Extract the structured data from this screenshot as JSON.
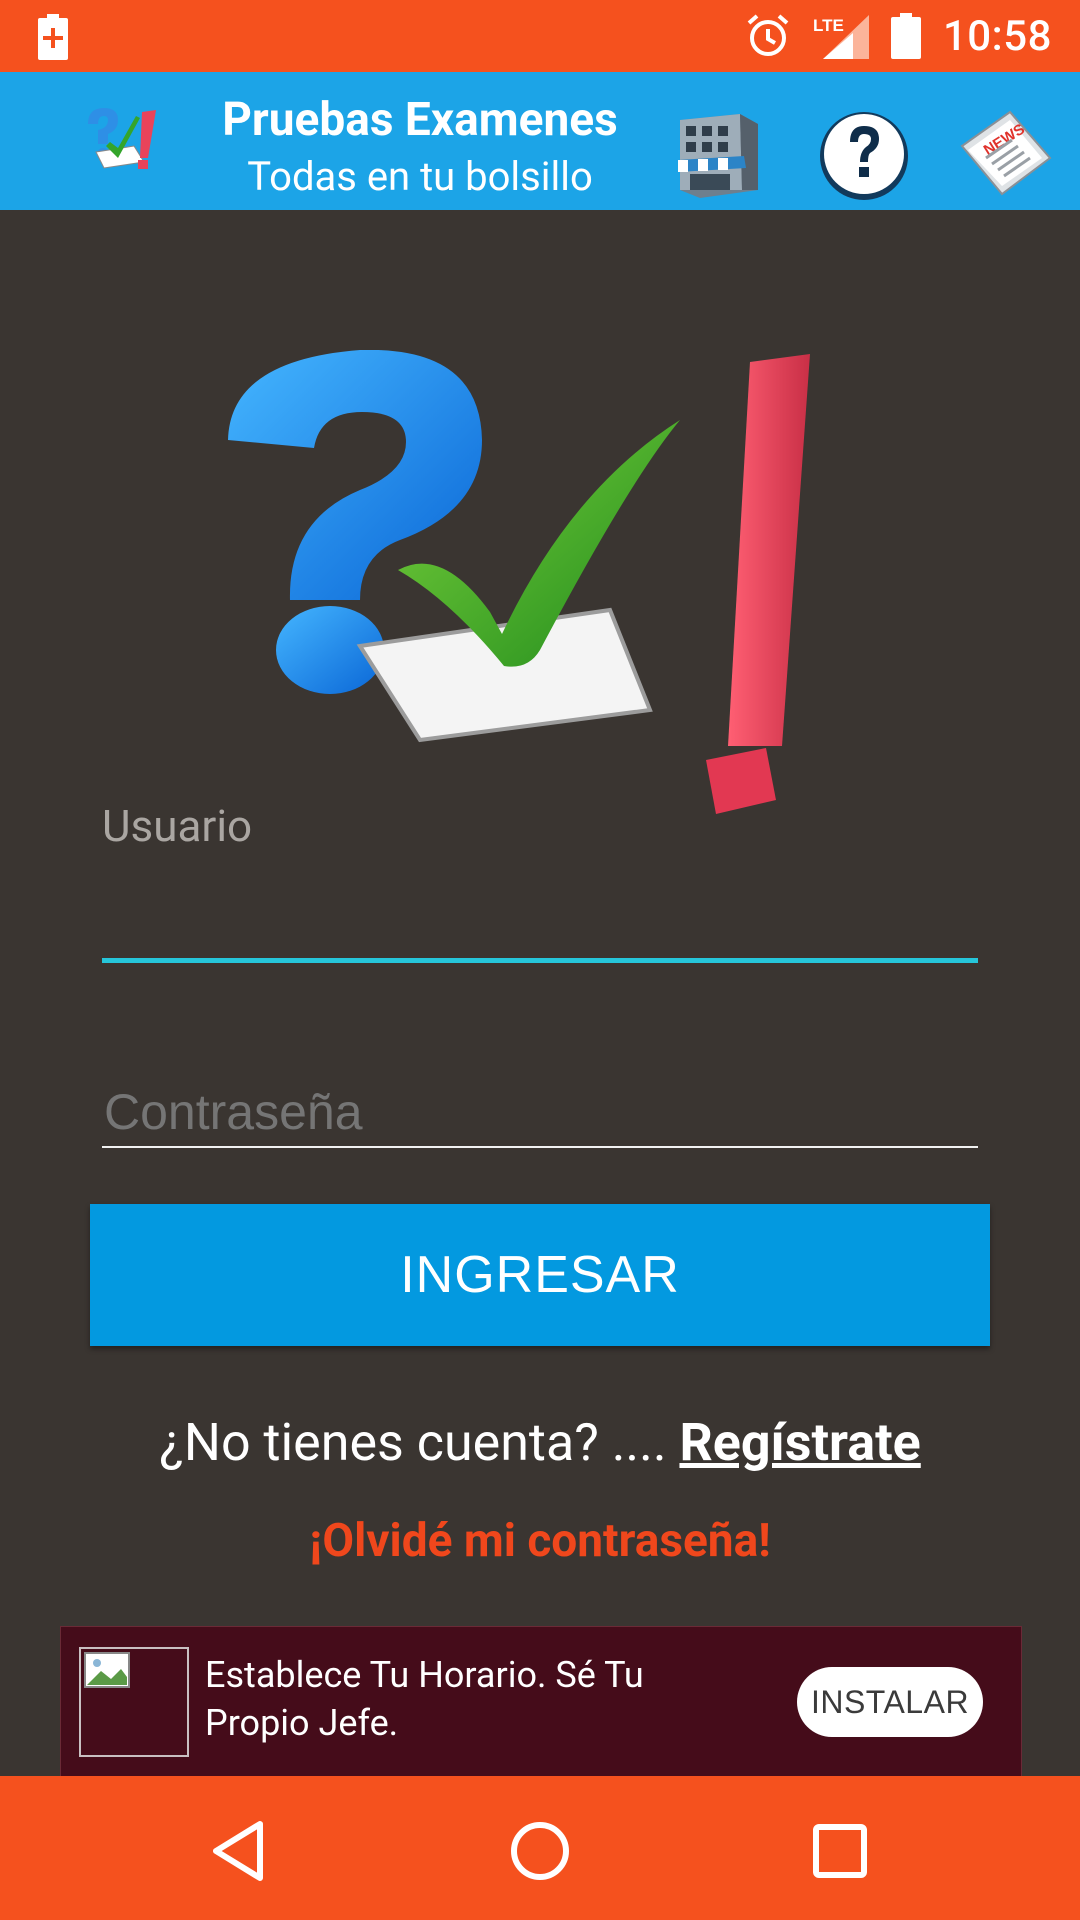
{
  "status_bar": {
    "time": "10:58",
    "icons": [
      "battery-saver-icon",
      "alarm-icon",
      "lte-signal-icon",
      "battery-icon"
    ],
    "network_label": "LTE"
  },
  "app_bar": {
    "title": "Pruebas Examenes",
    "subtitle": "Todas en tu bolsillo",
    "icons": [
      "app-logo-icon",
      "store-icon",
      "help-icon",
      "news-icon"
    ],
    "news_label": "NEWS"
  },
  "login": {
    "username_label": "Usuario",
    "username_value": "",
    "password_placeholder": "Contraseña",
    "password_value": "",
    "submit_label": "INGRESAR",
    "register_prompt": "¿No tienes cuenta? .... ",
    "register_link": "Regístrate",
    "forgot_link": "¡Olvidé mi contraseña!"
  },
  "ad": {
    "text": "Establece Tu Horario. Sé Tu Propio Jefe.",
    "cta": "INSTALAR"
  },
  "nav_bar": {
    "icons": [
      "back-icon",
      "home-icon",
      "recents-icon"
    ]
  },
  "colors": {
    "status_bar": "#f5511e",
    "app_bar": "#1ca4e7",
    "background": "#3a3531",
    "accent_underline": "#26c6da",
    "button": "#0399e0",
    "forgot_text": "#f0471c",
    "ad_background": "#450c1a"
  }
}
